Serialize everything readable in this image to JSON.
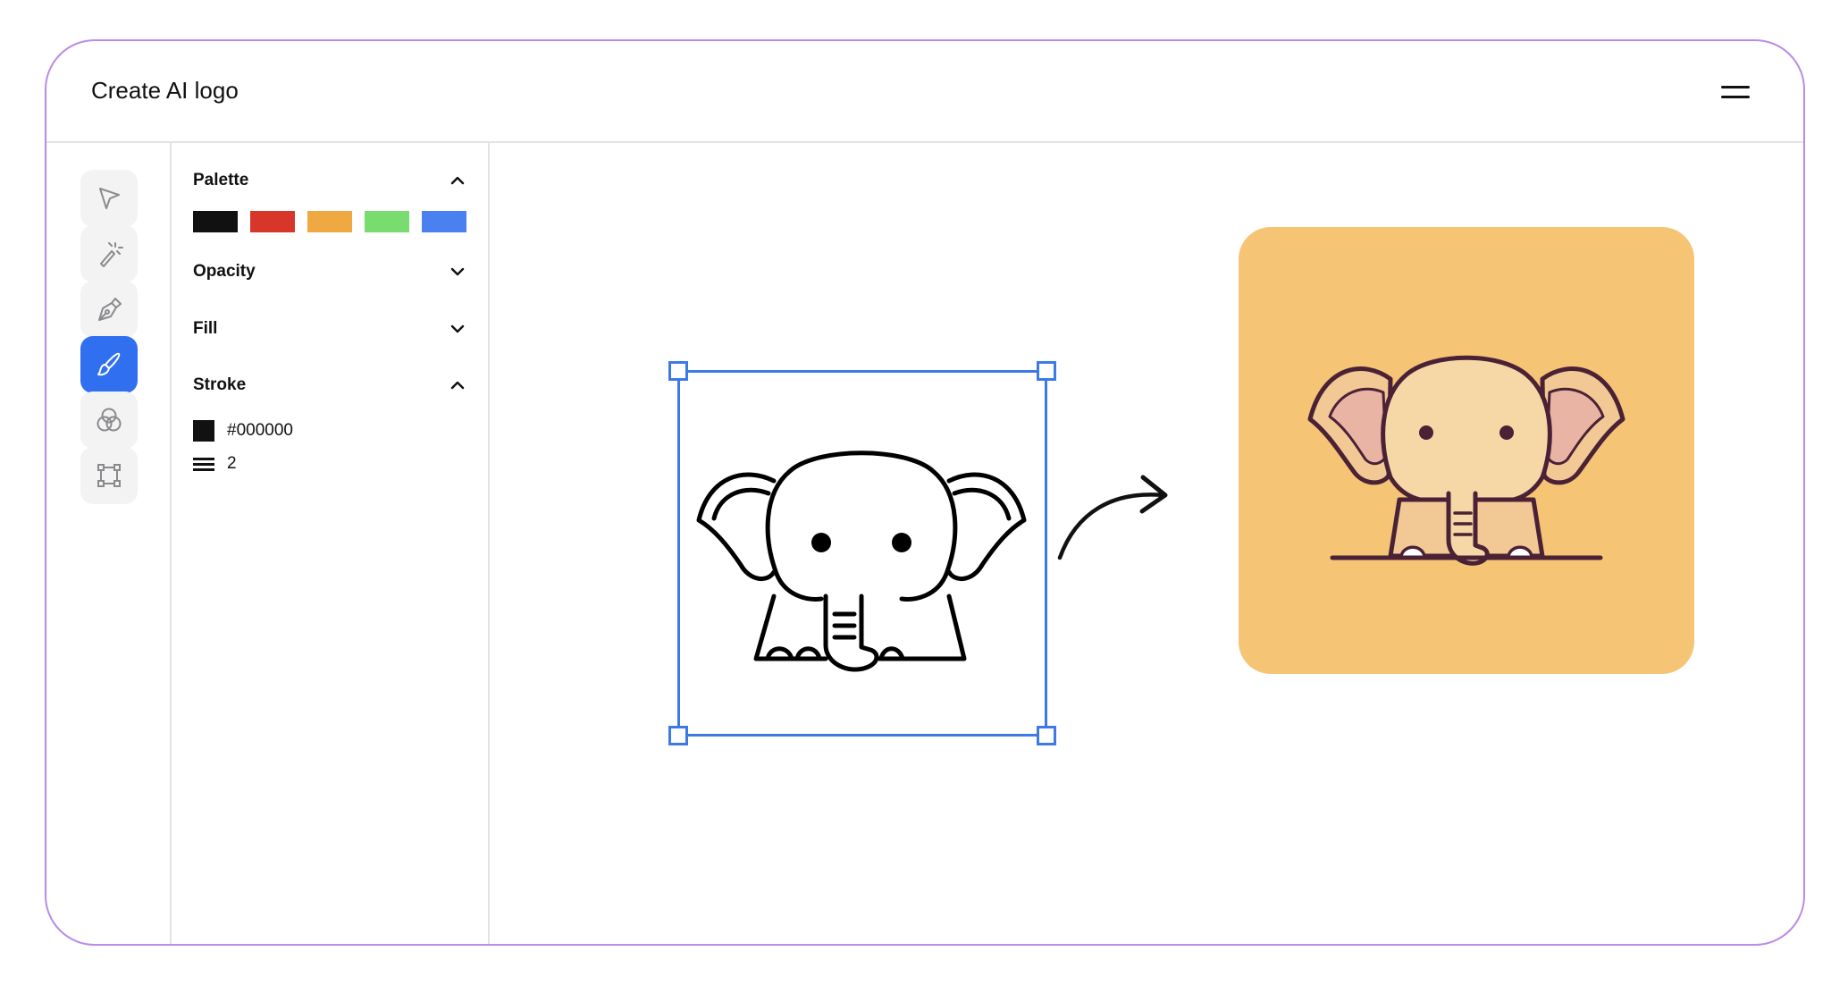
{
  "window": {
    "title": "Create AI logo",
    "menu_icon": "hamburger-menu-icon"
  },
  "toolbar": {
    "tools": [
      {
        "name": "select",
        "icon": "cursor-arrow-icon",
        "active": false
      },
      {
        "name": "magic-wand",
        "icon": "magic-wand-icon",
        "active": false
      },
      {
        "name": "pen",
        "icon": "pen-nib-icon",
        "active": false
      },
      {
        "name": "brush",
        "icon": "brush-icon",
        "active": true
      },
      {
        "name": "shapes",
        "icon": "overlapping-circles-icon",
        "active": false
      },
      {
        "name": "frame",
        "icon": "bounding-box-icon",
        "active": false
      }
    ],
    "accent_color": "#2f6ff0"
  },
  "panel": {
    "palette": {
      "label": "Palette",
      "expanded": true,
      "colors": [
        "#111111",
        "#d9362b",
        "#f0a842",
        "#78dd6e",
        "#4a80ef"
      ]
    },
    "opacity": {
      "label": "Opacity",
      "expanded": false
    },
    "fill": {
      "label": "Fill",
      "expanded": false
    },
    "stroke": {
      "label": "Stroke",
      "expanded": true,
      "color": "#000000",
      "color_label": "#000000",
      "weight": "2"
    }
  },
  "canvas": {
    "selection_color": "#3d7ae6",
    "sketch_icon": "elephant-outline-icon",
    "arrow_icon": "curved-arrow-right-icon",
    "result_icon": "elephant-logo-icon",
    "result_background": "#f5c475"
  }
}
